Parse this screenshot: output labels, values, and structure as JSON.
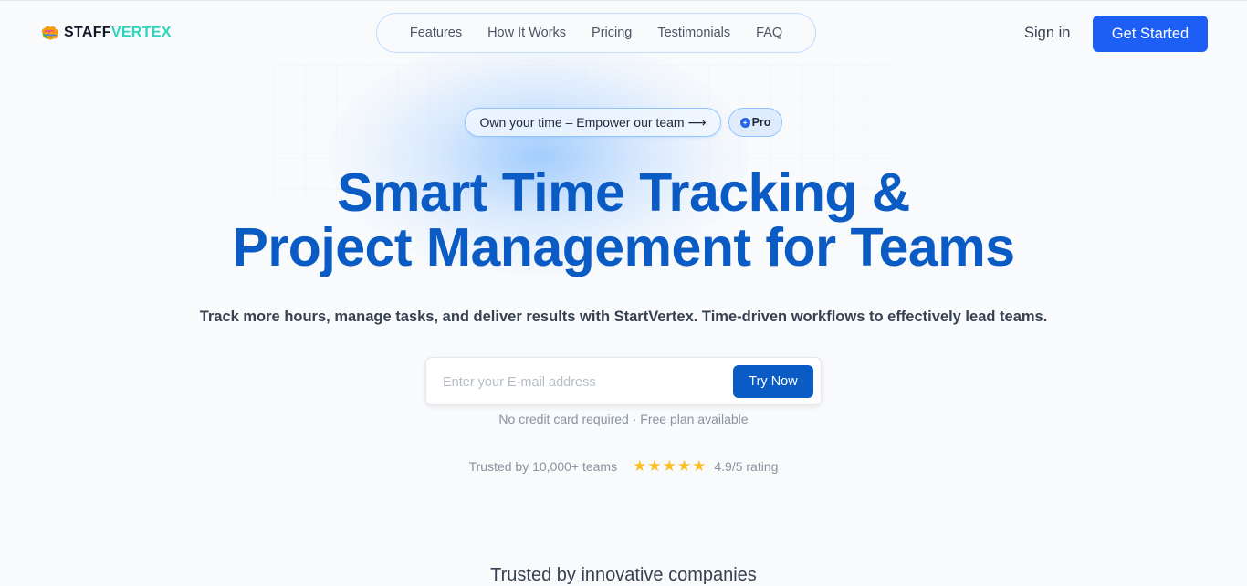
{
  "brand": {
    "name_part1": "STAFF",
    "name_part2": "VERTEX",
    "accent_color": "#2dd4bf",
    "logo_icon": "brain-logo-icon"
  },
  "nav": {
    "items": [
      {
        "label": "Features"
      },
      {
        "label": "How It Works"
      },
      {
        "label": "Pricing"
      },
      {
        "label": "Testimonials"
      },
      {
        "label": "FAQ"
      }
    ]
  },
  "header": {
    "signin_label": "Sign in",
    "cta_label": "Get Started",
    "cta_color": "#1d5ff5"
  },
  "announcement": {
    "text": "Own your time – Empower our team ⟶",
    "badge_label": "Pro",
    "badge_icon": "plus-circle-icon"
  },
  "hero": {
    "title_line1": "Smart Time Tracking &",
    "title_line2": "Project Management for Teams",
    "title_color": "#0a5bc4",
    "subtitle": "Track more hours, manage tasks, and deliver results with StartVertex. Time-driven workflows to effectively lead teams."
  },
  "signup": {
    "email_placeholder": "Enter your E-mail address",
    "email_value": "",
    "button_label": "Try Now",
    "note": "No credit card required · Free plan available"
  },
  "trust": {
    "teams_text": "Trusted by 10,000+ teams",
    "stars": 5,
    "rating_text": "4.9/5 rating",
    "star_color": "#fbbf24"
  },
  "companies": {
    "heading": "Trusted by innovative companies"
  }
}
